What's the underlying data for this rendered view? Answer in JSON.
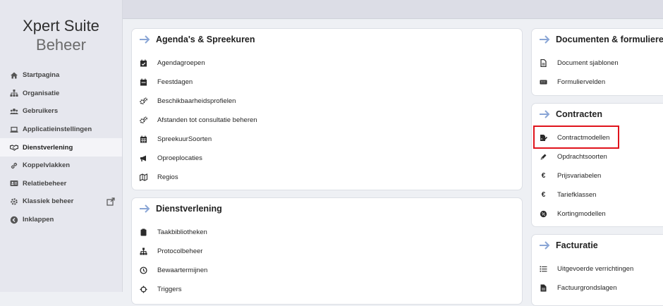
{
  "brand": {
    "line1": "Xpert Suite",
    "line2": "Beheer"
  },
  "sidebar": {
    "items": [
      {
        "label": "Startpagina",
        "icon": "home-icon"
      },
      {
        "label": "Organisatie",
        "icon": "sitemap-icon"
      },
      {
        "label": "Gebruikers",
        "icon": "users-icon"
      },
      {
        "label": "Applicatieinstellingen",
        "icon": "laptop-icon"
      },
      {
        "label": "Dienstverlening",
        "icon": "handshake-icon",
        "active": true
      },
      {
        "label": "Koppelvlakken",
        "icon": "link-icon"
      },
      {
        "label": "Relatiebeheer",
        "icon": "id-card-icon"
      },
      {
        "label": "Klassiek beheer",
        "icon": "gear-icon",
        "external": "external-link-icon"
      },
      {
        "label": "Inklappen",
        "icon": "collapse-icon"
      }
    ]
  },
  "cards": {
    "agenda": {
      "title": "Agenda's & Spreekuren",
      "items": [
        "Agendagroepen",
        "Feestdagen",
        "Beschikbaarheidsprofielen",
        "Afstanden tot consultatie beheren",
        "SpreekuurSoorten",
        "Oproeplocaties",
        "Regios"
      ]
    },
    "dienst": {
      "title": "Dienstverlening",
      "items": [
        "Taakbibliotheken",
        "Protocolbeheer",
        "Bewaartermijnen",
        "Triggers"
      ]
    },
    "documenten": {
      "title": "Documenten & formulieren",
      "items": [
        "Document sjablonen",
        "Formuliervelden"
      ]
    },
    "contracten": {
      "title": "Contracten",
      "items": [
        "Contractmodellen",
        "Opdrachtsoorten",
        "Prijsvariabelen",
        "Tariefklassen",
        "Kortingmodellen"
      ]
    },
    "facturatie": {
      "title": "Facturatie",
      "items": [
        "Uitgevoerde verrichtingen",
        "Factuurgrondslagen"
      ]
    }
  },
  "colors": {
    "accent_arrow": "#8aa6d6",
    "highlight": "#e0141c",
    "sidebar_bg": "#e6e7ee"
  }
}
